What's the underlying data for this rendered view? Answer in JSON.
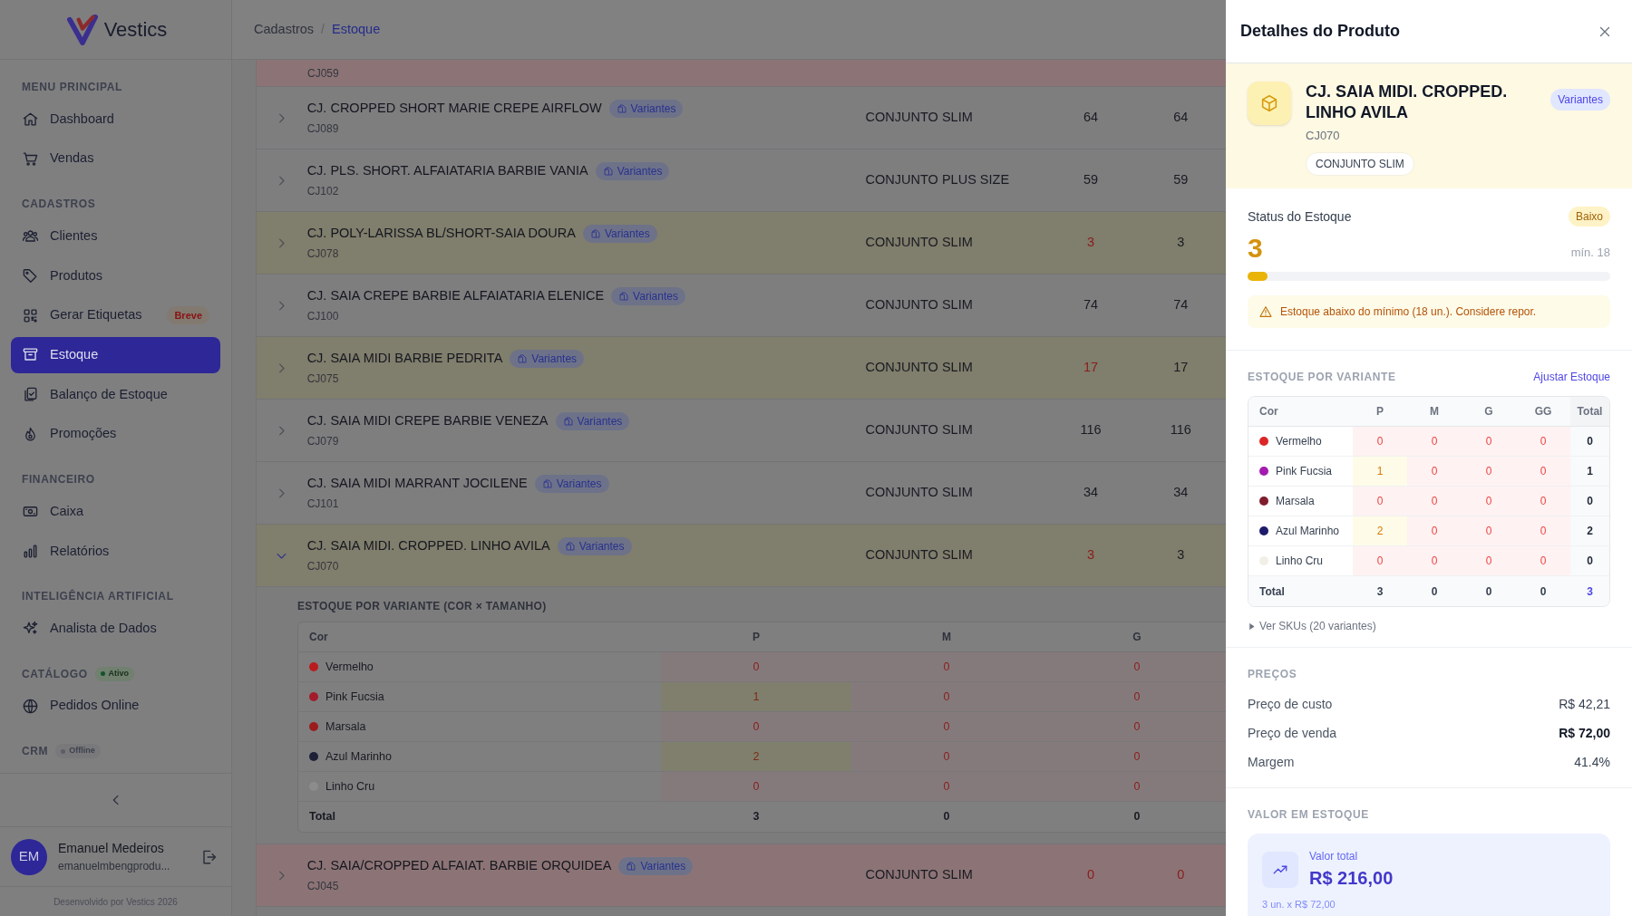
{
  "sidebar": {
    "logo": "Vestics",
    "sections": [
      {
        "title": "MENU PRINCIPAL",
        "items": [
          {
            "label": "Dashboard",
            "kind": "home",
            "selected": false
          },
          {
            "label": "Vendas",
            "kind": "cart",
            "selected": false
          }
        ]
      },
      {
        "title": "CADASTROS",
        "items": [
          {
            "label": "Clientes",
            "kind": "users",
            "selected": false
          },
          {
            "label": "Produtos",
            "kind": "tag",
            "selected": false
          },
          {
            "label": "Gerar Etiquetas",
            "kind": "qr",
            "selected": false,
            "badge": "Breve"
          },
          {
            "label": "Estoque",
            "kind": "archive",
            "selected": true
          },
          {
            "label": "Balanço de Estoque",
            "kind": "clipboard",
            "selected": false
          },
          {
            "label": "Promoções",
            "kind": "flame",
            "selected": false
          }
        ]
      },
      {
        "title": "FINANCEIRO",
        "items": [
          {
            "label": "Caixa",
            "kind": "cash",
            "selected": false
          },
          {
            "label": "Relatórios",
            "kind": "bars",
            "selected": false
          }
        ]
      },
      {
        "title": "INTELIGÊNCIA ARTIFICIAL",
        "items": [
          {
            "label": "Analista de Dados",
            "kind": "sparkles",
            "selected": false
          }
        ]
      },
      {
        "title": "CATÁLOGO",
        "status": {
          "label": "Ativo",
          "online": true
        },
        "items": [
          {
            "label": "Pedidos Online",
            "kind": "globe",
            "selected": false
          }
        ]
      },
      {
        "title": "CRM",
        "status": {
          "label": "Offline",
          "online": false
        }
      }
    ],
    "user": {
      "initials": "EM",
      "name": "Emanuel Medeiros",
      "email": "emanuelmbengprodu..."
    },
    "footer": "Desenvolvido por Vestics 2026"
  },
  "breadcrumb": {
    "separator": "/",
    "items": [
      {
        "label": "Cadastros",
        "current": false
      },
      {
        "label": "Estoque",
        "current": true
      }
    ]
  },
  "products": [
    {
      "kind": "partial",
      "code": "CJ059",
      "out_of_stock": true
    },
    {
      "kind": "row",
      "name": "CJ. CROPPED SHORT MARIE CREPE AIRFLOW",
      "badge": "Variantes",
      "code": "CJ089",
      "category": "CONJUNTO SLIM",
      "stock": "64",
      "total": "64",
      "low_stock": false,
      "out_of_stock": false,
      "expanded": false
    },
    {
      "kind": "row",
      "name": "CJ. PLS. SHORT. ALFAIATARIA BARBIE VANIA",
      "badge": "Variantes",
      "code": "CJ102",
      "category": "CONJUNTO PLUS SIZE",
      "stock": "59",
      "total": "59",
      "low_stock": false,
      "out_of_stock": false,
      "expanded": false
    },
    {
      "kind": "row",
      "name": "CJ. POLY-LARISSA BL/SHORT-SAIA DOURA",
      "badge": "Variantes",
      "code": "CJ078",
      "category": "CONJUNTO SLIM",
      "stock": "3",
      "total": "3",
      "low_stock": true,
      "out_of_stock": false,
      "expanded": false
    },
    {
      "kind": "row",
      "name": "CJ. SAIA CREPE BARBIE ALFAIATARIA ELENICE",
      "badge": "Variantes",
      "code": "CJ100",
      "category": "CONJUNTO SLIM",
      "stock": "74",
      "total": "74",
      "low_stock": false,
      "out_of_stock": false,
      "expanded": false
    },
    {
      "kind": "row",
      "name": "CJ. SAIA MIDI BARBIE PEDRITA",
      "badge": "Variantes",
      "code": "CJ075",
      "category": "CONJUNTO SLIM",
      "stock": "17",
      "total": "17",
      "low_stock": true,
      "out_of_stock": false,
      "expanded": false
    },
    {
      "kind": "row",
      "name": "CJ. SAIA MIDI CREPE BARBIE VENEZA",
      "badge": "Variantes",
      "code": "CJ079",
      "category": "CONJUNTO SLIM",
      "stock": "116",
      "total": "116",
      "low_stock": false,
      "out_of_stock": false,
      "expanded": false
    },
    {
      "kind": "row",
      "name": "CJ. SAIA MIDI MARRANT JOCILENE",
      "badge": "Variantes",
      "code": "CJ101",
      "category": "CONJUNTO SLIM",
      "stock": "34",
      "total": "34",
      "low_stock": false,
      "out_of_stock": false,
      "expanded": false
    },
    {
      "kind": "row",
      "name": "CJ. SAIA MIDI. CROPPED. LINHO AVILA",
      "badge": "Variantes",
      "code": "CJ070",
      "category": "CONJUNTO SLIM",
      "stock": "3",
      "total": "3",
      "low_stock": true,
      "out_of_stock": false,
      "expanded": true,
      "breakdown": {
        "title": "ESTOQUE POR VARIANTE (COR × TAMANHO)",
        "columns": [
          "Cor",
          "P",
          "M",
          "G"
        ],
        "rows": [
          {
            "cells": [
              {
                "kind": "color",
                "value": "Vermelho",
                "color": "#b91c1c"
              },
              {
                "kind": "count",
                "value": "0",
                "out_of_stock": true
              },
              {
                "kind": "count",
                "value": "0",
                "out_of_stock": true
              },
              {
                "kind": "count",
                "value": "0",
                "out_of_stock": true
              }
            ]
          },
          {
            "cells": [
              {
                "kind": "color",
                "value": "Pink Fucsia",
                "color": "#a21c2c"
              },
              {
                "kind": "count",
                "value": "1",
                "out_of_stock": false
              },
              {
                "kind": "count",
                "value": "0",
                "out_of_stock": true
              },
              {
                "kind": "count",
                "value": "0",
                "out_of_stock": true
              }
            ]
          },
          {
            "cells": [
              {
                "kind": "color",
                "value": "Marsala",
                "color": "#9b1c1c"
              },
              {
                "kind": "count",
                "value": "0",
                "out_of_stock": true
              },
              {
                "kind": "count",
                "value": "0",
                "out_of_stock": true
              },
              {
                "kind": "count",
                "value": "0",
                "out_of_stock": true
              }
            ]
          },
          {
            "cells": [
              {
                "kind": "color",
                "value": "Azul Marinho",
                "color": "#1e2038"
              },
              {
                "kind": "count",
                "value": "2",
                "out_of_stock": false
              },
              {
                "kind": "count",
                "value": "0",
                "out_of_stock": true
              },
              {
                "kind": "count",
                "value": "0",
                "out_of_stock": true
              }
            ]
          },
          {
            "cells": [
              {
                "kind": "color",
                "value": "Linho Cru",
                "color": "#8c8c8c"
              },
              {
                "kind": "count",
                "value": "0",
                "out_of_stock": true
              },
              {
                "kind": "count",
                "value": "0",
                "out_of_stock": true
              },
              {
                "kind": "count",
                "value": "0",
                "out_of_stock": true
              }
            ]
          }
        ],
        "total": [
          "Total",
          "3",
          "0",
          "0"
        ]
      }
    },
    {
      "kind": "row",
      "name": "CJ. SAIA/CROPPED ALFAIAT. BARBIE ORQUIDEA",
      "badge": "Variantes",
      "code": "CJ045",
      "category": "CONJUNTO SLIM",
      "stock": "0",
      "total": "0",
      "low_stock": true,
      "out_of_stock": true,
      "expanded": false
    }
  ],
  "panel": {
    "title": "Detalhes do Produto",
    "product": {
      "name": "CJ. SAIA MIDI. CROPPED. LINHO AVILA",
      "badge": "Variantes",
      "code": "CJ070",
      "category": "CONJUNTO SLIM"
    },
    "stock_status": {
      "title": "Status do Estoque",
      "badge": "Baixo",
      "quantity": "3",
      "minimum": "mín. 18",
      "level": 0.055,
      "warning": "Estoque abaixo do mínimo (18 un.). Considere repor."
    },
    "variants": {
      "title": "ESTOQUE POR VARIANTE",
      "action": "Ajustar Estoque",
      "columns": [
        "Cor",
        "P",
        "M",
        "G",
        "GG",
        "Total"
      ],
      "rows": [
        {
          "cells": [
            {
              "kind": "color",
              "value": "Vermelho",
              "color": "#dc2626"
            },
            {
              "kind": "count",
              "value": "0",
              "out_of_stock": true
            },
            {
              "kind": "count",
              "value": "0",
              "out_of_stock": true
            },
            {
              "kind": "count",
              "value": "0",
              "out_of_stock": true
            },
            {
              "kind": "count",
              "value": "0",
              "out_of_stock": true
            },
            {
              "kind": "total",
              "value": "0"
            }
          ]
        },
        {
          "cells": [
            {
              "kind": "color",
              "value": "Pink Fucsia",
              "color": "#a21caf"
            },
            {
              "kind": "count",
              "value": "1",
              "out_of_stock": false
            },
            {
              "kind": "count",
              "value": "0",
              "out_of_stock": true
            },
            {
              "kind": "count",
              "value": "0",
              "out_of_stock": true
            },
            {
              "kind": "count",
              "value": "0",
              "out_of_stock": true
            },
            {
              "kind": "total",
              "value": "1"
            }
          ]
        },
        {
          "cells": [
            {
              "kind": "color",
              "value": "Marsala",
              "color": "#7f1d2d"
            },
            {
              "kind": "count",
              "value": "0",
              "out_of_stock": true
            },
            {
              "kind": "count",
              "value": "0",
              "out_of_stock": true
            },
            {
              "kind": "count",
              "value": "0",
              "out_of_stock": true
            },
            {
              "kind": "count",
              "value": "0",
              "out_of_stock": true
            },
            {
              "kind": "total",
              "value": "0"
            }
          ]
        },
        {
          "cells": [
            {
              "kind": "color",
              "value": "Azul Marinho",
              "color": "#1e1b6b"
            },
            {
              "kind": "count",
              "value": "2",
              "out_of_stock": false
            },
            {
              "kind": "count",
              "value": "0",
              "out_of_stock": true
            },
            {
              "kind": "count",
              "value": "0",
              "out_of_stock": true
            },
            {
              "kind": "count",
              "value": "0",
              "out_of_stock": true
            },
            {
              "kind": "total",
              "value": "2"
            }
          ]
        },
        {
          "cells": [
            {
              "kind": "color",
              "value": "Linho Cru",
              "color": "#f1efe6"
            },
            {
              "kind": "count",
              "value": "0",
              "out_of_stock": true
            },
            {
              "kind": "count",
              "value": "0",
              "out_of_stock": true
            },
            {
              "kind": "count",
              "value": "0",
              "out_of_stock": true
            },
            {
              "kind": "count",
              "value": "0",
              "out_of_stock": true
            },
            {
              "kind": "total",
              "value": "0"
            }
          ]
        }
      ],
      "total": [
        "Total",
        "3",
        "0",
        "0",
        "0",
        "3"
      ],
      "skus": "Ver SKUs (20 variantes)"
    },
    "prices": {
      "title": "PREÇOS",
      "rows": [
        {
          "label": "Preço de custo",
          "value": "R$ 42,21",
          "emphasis": false
        },
        {
          "label": "Preço de venda",
          "value": "R$ 72,00",
          "emphasis": true
        },
        {
          "label": "Margem",
          "value": "41.4%",
          "emphasis": false
        }
      ]
    },
    "stock_value": {
      "title": "VALOR EM ESTOQUE",
      "label": "Valor total",
      "value": "R$ 216,00",
      "detail": "3 un. x R$ 72,00"
    }
  }
}
